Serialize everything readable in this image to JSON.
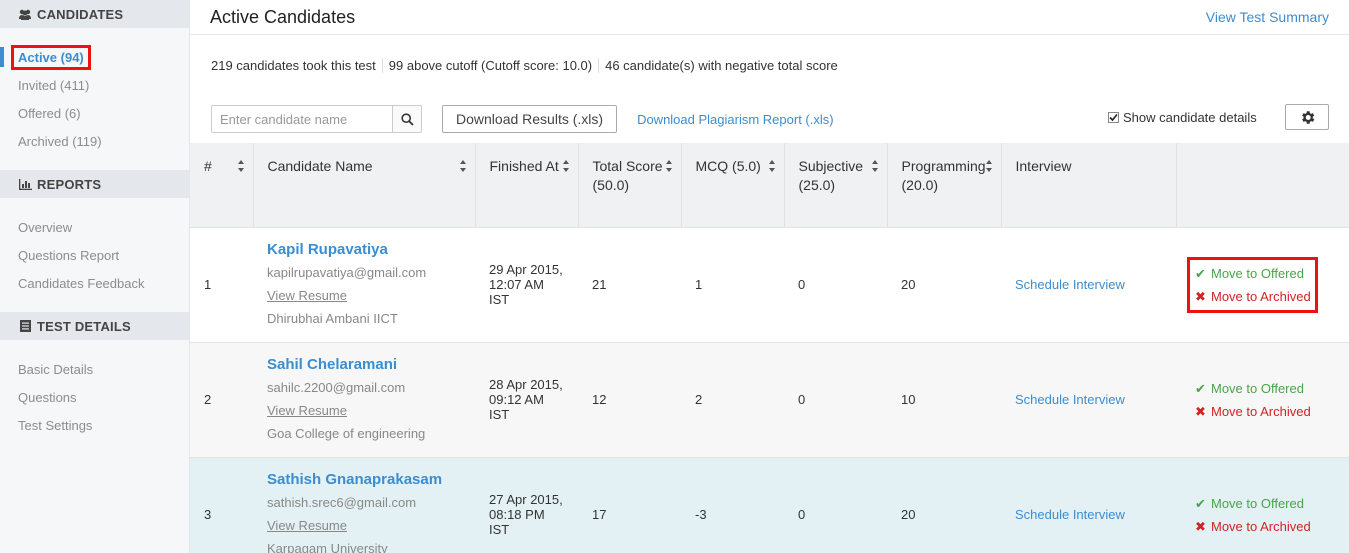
{
  "sidebar": {
    "sections": [
      {
        "title": "CANDIDATES",
        "icon": "users-icon",
        "items": [
          {
            "label": "Active (94)",
            "active": true
          },
          {
            "label": "Invited (411)"
          },
          {
            "label": "Offered (6)"
          },
          {
            "label": "Archived (119)"
          }
        ]
      },
      {
        "title": "REPORTS",
        "icon": "bar-chart-icon",
        "items": [
          {
            "label": "Overview"
          },
          {
            "label": "Questions Report"
          },
          {
            "label": "Candidates Feedback"
          }
        ]
      },
      {
        "title": "TEST DETAILS",
        "icon": "document-icon",
        "items": [
          {
            "label": "Basic Details"
          },
          {
            "label": "Questions"
          },
          {
            "label": "Test Settings"
          }
        ]
      }
    ]
  },
  "header": {
    "title": "Active Candidates",
    "summary_link": "View Test Summary"
  },
  "stats": [
    "219 candidates took this test",
    "99 above cutoff (Cutoff score: 10.0)",
    "46 candidate(s) with negative total score"
  ],
  "controls": {
    "search_placeholder": "Enter candidate name",
    "download_results": "Download Results (.xls)",
    "download_plagiarism": "Download Plagiarism Report (.xls)",
    "show_details_label": "Show candidate details",
    "show_details_checked": true
  },
  "table": {
    "columns": [
      "#",
      "Candidate Name",
      "Finished At",
      "Total Score (50.0)",
      "MCQ (5.0)",
      "Subjective (25.0)",
      "Programming (20.0)",
      "Interview",
      ""
    ],
    "rows": [
      {
        "num": "1",
        "name": "Kapil Rupavatiya",
        "email": "kapilrupavatiya@gmail.com",
        "resume": "View Resume",
        "college": "Dhirubhai Ambani IICT",
        "finished": "29 Apr 2015, 12:07 AM IST",
        "total": "21",
        "mcq": "1",
        "subjective": "0",
        "programming": "20",
        "interview": "Schedule Interview",
        "offer": "Move to Offered",
        "archive": "Move to Archived"
      },
      {
        "num": "2",
        "name": "Sahil Chelaramani",
        "email": "sahilc.2200@gmail.com",
        "resume": "View Resume",
        "college": "Goa College of engineering",
        "finished": "28 Apr 2015, 09:12 AM IST",
        "total": "12",
        "mcq": "2",
        "subjective": "0",
        "programming": "10",
        "interview": "Schedule Interview",
        "offer": "Move to Offered",
        "archive": "Move to Archived"
      },
      {
        "num": "3",
        "name": "Sathish Gnanaprakasam",
        "email": "sathish.srec6@gmail.com",
        "resume": "View Resume",
        "college": "Karpagam University",
        "finished": "27 Apr 2015, 08:18 PM IST",
        "total": "17",
        "mcq": "-3",
        "subjective": "0",
        "programming": "20",
        "interview": "Schedule Interview",
        "offer": "Move to Offered",
        "archive": "Move to Archived"
      }
    ]
  },
  "colors": {
    "accent": "#3c8dd0",
    "offer_green": "#4aa34a",
    "archive_red": "#d32222",
    "highlight_box": "#ee1111"
  }
}
